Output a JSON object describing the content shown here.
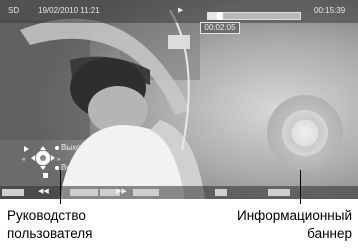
{
  "banner": {
    "channel": "SD",
    "datetime": "19/02/2010 11:21",
    "play_icon": "play-icon",
    "elapsed": "00:02:05",
    "total": "00:15:39",
    "progress_fraction": 0.13
  },
  "guide": {
    "exit_label": "Выход",
    "return_label": "Возврат",
    "nav_icon": "dpad-icon"
  },
  "callouts": {
    "left_line1": "Руководство",
    "left_line2": "пользователя",
    "right_line1": "Информационный",
    "right_line2": "баннер"
  }
}
